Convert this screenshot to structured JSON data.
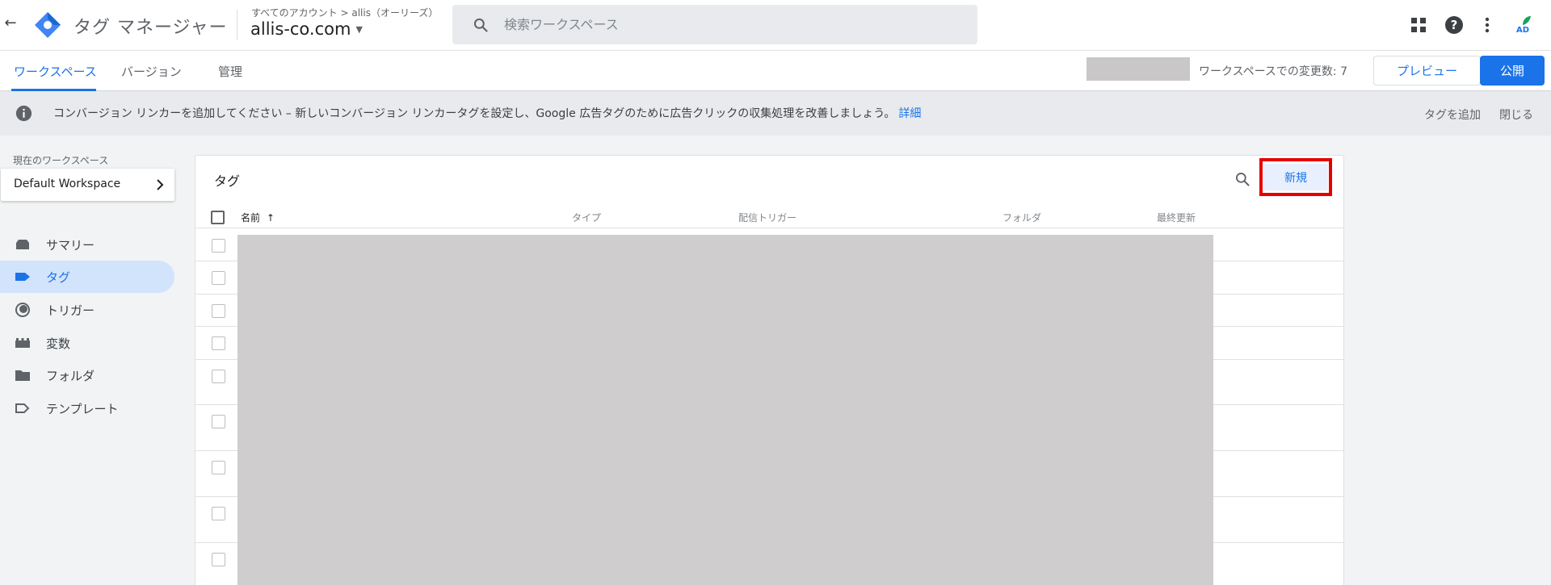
{
  "topbar": {
    "app_title": "タグ マネージャー",
    "breadcrumb": "すべてのアカウント > allis（オーリーズ）",
    "container_name": "allis-co.com",
    "search_placeholder": "検索ワークスペース",
    "avatar_initials": "AD"
  },
  "subnav": {
    "tabs": [
      {
        "label": "ワークスペース"
      },
      {
        "label": "バージョン"
      },
      {
        "label": "管理"
      }
    ],
    "changes_text": "ワークスペースでの変更数: 7",
    "preview_label": "プレビュー",
    "publish_label": "公開"
  },
  "banner": {
    "text": "コンバージョン リンカーを追加してください – 新しいコンバージョン リンカータグを設定し、Google 広告タグのために広告クリックの収集処理を改善しましょう。",
    "link_label": "詳細",
    "add_tag_label": "タグを追加",
    "close_label": "閉じる"
  },
  "sidebar": {
    "workspace_label": "現在のワークスペース",
    "workspace_name": "Default Workspace",
    "items": [
      {
        "label": "サマリー",
        "icon": "summary-icon"
      },
      {
        "label": "タグ",
        "icon": "tag-icon"
      },
      {
        "label": "トリガー",
        "icon": "trigger-icon"
      },
      {
        "label": "変数",
        "icon": "variables-icon"
      },
      {
        "label": "フォルダ",
        "icon": "folder-icon"
      },
      {
        "label": "テンプレート",
        "icon": "template-icon"
      }
    ]
  },
  "main": {
    "title": "タグ",
    "new_label": "新規",
    "columns": [
      "名前",
      "タイプ",
      "配信トリガー",
      "フォルダ",
      "最終更新"
    ],
    "sort_indicator": "↑"
  },
  "colors": {
    "accent": "#1a73e8",
    "highlight_box": "#e50000",
    "redaction": "#cfcdce"
  }
}
